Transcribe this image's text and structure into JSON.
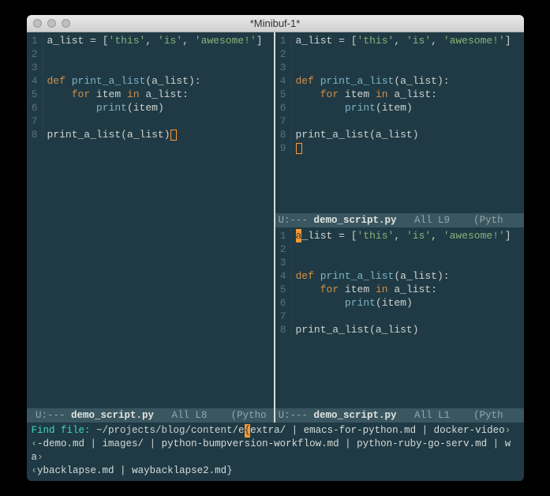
{
  "window": {
    "title": "*Minibuf-1*"
  },
  "code": {
    "l1_a": "a_list = [",
    "l1_s1": "'this'",
    "l1_c1": ", ",
    "l1_s2": "'is'",
    "l1_c2": ", ",
    "l1_s3": "'awesome!'",
    "l1_b": "]",
    "l4_def": "def",
    "l4_sp": " ",
    "l4_fn": "print_a_list",
    "l4_sig": "(a_list):",
    "l5_ind": "    ",
    "l5_for": "for",
    "l5_mid": " item ",
    "l5_in": "in",
    "l5_rest": " a_list:",
    "l6_ind": "        ",
    "l6_print": "print",
    "l6_arg": "(item)",
    "l8": "print_a_list(a_list)"
  },
  "gutters": [
    "1",
    "2",
    "3",
    "4",
    "5",
    "6",
    "7",
    "8",
    "9"
  ],
  "cursor_char_a": "a",
  "modeline_left": {
    "prefix": " U:--- ",
    "file": "demo_script.py",
    "mid": "   All L8    (Pytho"
  },
  "modeline_rt": {
    "prefix": "U:--- ",
    "file": "demo_script.py",
    "mid": "   All L9    (Pyth"
  },
  "modeline_rb": {
    "prefix": "U:--- ",
    "file": "demo_script.py",
    "mid": "   All L1    (Pyth"
  },
  "minibuffer": {
    "prompt": "Find file: ",
    "path": "~/projects/blog/content/e",
    "cursor_seg": "{",
    "after_cursor": "extra/",
    "sep": " | ",
    "comps": [
      "emacs-for-python.md",
      "docker-video-demo.md",
      "images/",
      "python-bumpversion-workflow.md",
      "python-ruby-go-serv.md",
      "waybacklapse.md",
      "waybacklapse2.md"
    ],
    "close": "}",
    "cont_left": "‹",
    "cont_right": "›"
  }
}
